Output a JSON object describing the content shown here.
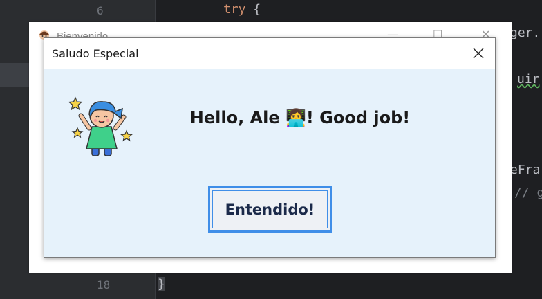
{
  "editor": {
    "line_top": "6",
    "line_bottom": "18",
    "code_try": "try {",
    "code_brace": "}",
    "fragment_ger": "ger.",
    "fragment_uir": "uir",
    "fragment_efra": "eFra",
    "fragment_comment": "// g"
  },
  "parent_window": {
    "title": "Bienvenido",
    "minimize_symbol": "—",
    "maximize_symbol": "☐",
    "close_symbol": "✕"
  },
  "dialog": {
    "title": "Saludo Especial",
    "message": "Hello, Ale 👩‍💻! Good job!",
    "ok_label": "Entendido!",
    "avatar_icon": "cheering-child-with-stars-icon",
    "close_icon": "close-icon",
    "colors": {
      "background": "#e6f2fb",
      "button_border": "#3f8ee8"
    }
  }
}
